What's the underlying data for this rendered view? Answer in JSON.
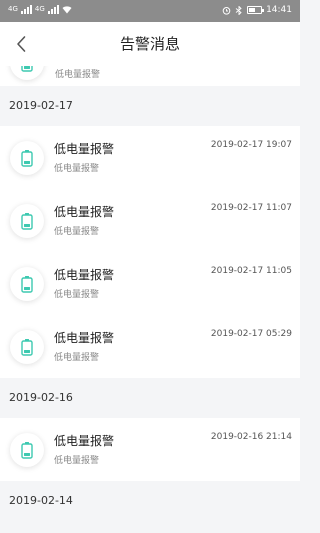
{
  "status_bar": {
    "time": "14:41",
    "left_signal_1": "4G",
    "left_signal_2": "4G",
    "battery_icon": "battery-icon"
  },
  "header": {
    "title": "告警消息"
  },
  "accent_color": "#3dc9b0",
  "partial_item": {
    "subtitle": "低电量报警"
  },
  "groups": [
    {
      "date": "2019-02-17",
      "items": [
        {
          "title": "低电量报警",
          "subtitle": "低电量报警",
          "time": "2019-02-17 19:07"
        },
        {
          "title": "低电量报警",
          "subtitle": "低电量报警",
          "time": "2019-02-17 11:07"
        },
        {
          "title": "低电量报警",
          "subtitle": "低电量报警",
          "time": "2019-02-17 11:05"
        },
        {
          "title": "低电量报警",
          "subtitle": "低电量报警",
          "time": "2019-02-17 05:29"
        }
      ]
    },
    {
      "date": "2019-02-16",
      "items": [
        {
          "title": "低电量报警",
          "subtitle": "低电量报警",
          "time": "2019-02-16 21:14"
        }
      ]
    },
    {
      "date": "2019-02-14",
      "items": []
    }
  ]
}
